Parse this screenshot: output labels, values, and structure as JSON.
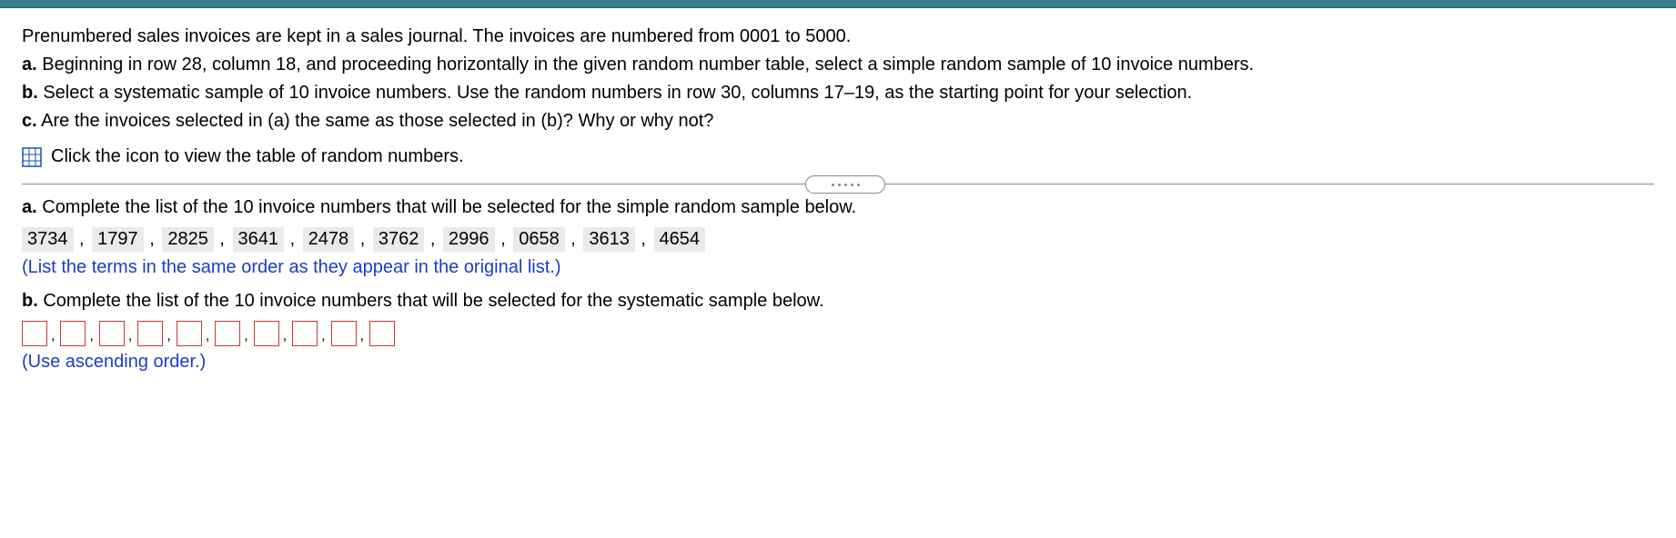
{
  "question": {
    "intro": "Prenumbered sales invoices are kept in a sales journal. The invoices are numbered from 0001 to 5000.",
    "a_label": "a.",
    "a_text": " Beginning in row 28, column 18, and proceeding horizontally in the given random number table, select a simple random sample of 10 invoice numbers.",
    "b_label": "b.",
    "b_text": " Select a systematic sample of 10 invoice numbers. Use the random numbers in row 30, columns 17–19, as the starting point for your selection.",
    "c_label": "c.",
    "c_text": " Are the invoices selected in (a) the same as those selected in (b)? Why or why not?",
    "link_text": "Click the icon to view the table of random numbers."
  },
  "partA": {
    "label": "a.",
    "prompt": " Complete the list of the 10 invoice numbers that will be selected for the simple random sample below.",
    "answers": [
      "3734",
      "1797",
      "2825",
      "3641",
      "2478",
      "3762",
      "2996",
      "0658",
      "3613",
      "4654"
    ],
    "note": "(List the terms in the same order as they appear in the original list.)"
  },
  "partB": {
    "label": "b.",
    "prompt": " Complete the list of the 10 invoice numbers that will be selected for the systematic sample below.",
    "count": 10,
    "note": "(Use ascending order.)"
  }
}
